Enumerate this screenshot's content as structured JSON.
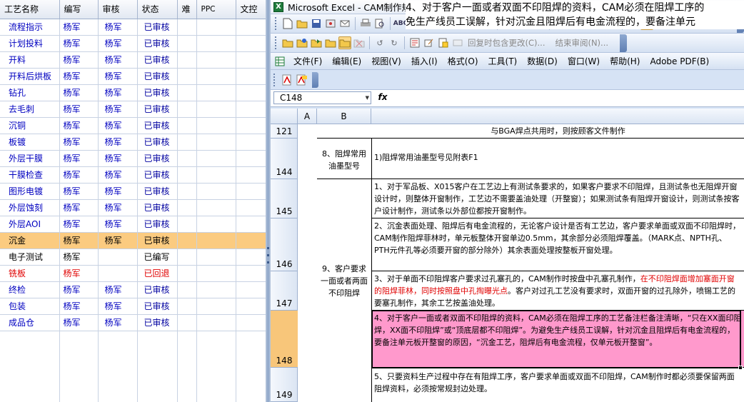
{
  "left_panel": {
    "columns": [
      "工艺名称",
      "编写",
      "审核",
      "状态",
      "难",
      "PPC",
      "文控"
    ],
    "rows": [
      {
        "name": "流程指示",
        "writer": "杨军",
        "reviewer": "杨军",
        "status": "已审核",
        "kind": "rv"
      },
      {
        "name": "计划投料",
        "writer": "杨军",
        "reviewer": "杨军",
        "status": "已审核",
        "kind": "rv"
      },
      {
        "name": "开料",
        "writer": "杨军",
        "reviewer": "杨军",
        "status": "已审核",
        "kind": "rv"
      },
      {
        "name": "开料后烘板",
        "writer": "杨军",
        "reviewer": "杨军",
        "status": "已审核",
        "kind": "rv"
      },
      {
        "name": "钻孔",
        "writer": "杨军",
        "reviewer": "杨军",
        "status": "已审核",
        "kind": "rv"
      },
      {
        "name": "去毛刺",
        "writer": "杨军",
        "reviewer": "杨军",
        "status": "已审核",
        "kind": "rv"
      },
      {
        "name": "沉铜",
        "writer": "杨军",
        "reviewer": "杨军",
        "status": "已审核",
        "kind": "rv"
      },
      {
        "name": "板镀",
        "writer": "杨军",
        "reviewer": "杨军",
        "status": "已审核",
        "kind": "rv"
      },
      {
        "name": "外层干膜",
        "writer": "杨军",
        "reviewer": "杨军",
        "status": "已审核",
        "kind": "rv"
      },
      {
        "name": "干膜检查",
        "writer": "杨军",
        "reviewer": "杨军",
        "status": "已审核",
        "kind": "rv"
      },
      {
        "name": "图形电镀",
        "writer": "杨军",
        "reviewer": "杨军",
        "status": "已审核",
        "kind": "rv"
      },
      {
        "name": "外层蚀刻",
        "writer": "杨军",
        "reviewer": "杨军",
        "status": "已审核",
        "kind": "rv"
      },
      {
        "name": "外层AOI",
        "writer": "杨军",
        "reviewer": "杨军",
        "status": "已审核",
        "kind": "rv"
      },
      {
        "name": "沉金",
        "writer": "杨军",
        "reviewer": "杨军",
        "status": "已审核",
        "kind": "sel"
      },
      {
        "name": "电子测试",
        "writer": "杨军",
        "reviewer": "",
        "status": "已编写",
        "kind": "grey"
      },
      {
        "name": "铣板",
        "writer": "杨军",
        "reviewer": "",
        "status": "已回退",
        "kind": "rej"
      },
      {
        "name": "终检",
        "writer": "杨军",
        "reviewer": "杨军",
        "status": "已审核",
        "kind": "rv"
      },
      {
        "name": "包装",
        "writer": "杨军",
        "reviewer": "杨军",
        "status": "已审核",
        "kind": "rv"
      },
      {
        "name": "成品仓",
        "writer": "杨军",
        "reviewer": "杨军",
        "status": "已审核",
        "kind": "rv"
      }
    ]
  },
  "excel": {
    "window_title": "Microsoft Excel - CAM制作规范.xls",
    "app_icon_letter": "X",
    "toolbar_reply_text": "回复时包含更改(C)...",
    "toolbar_end_review_text": "结束审阅(N)...",
    "menus": [
      "文件(F)",
      "编辑(E)",
      "视图(V)",
      "插入(I)",
      "格式(O)",
      "工具(T)",
      "数据(D)",
      "窗口(W)",
      "帮助(H)",
      "Adobe PDF(B)"
    ],
    "name_box": "C148",
    "fx_label": "fx",
    "formula_line1": "4、对于客户一面或者双面不印阻焊的资料，CAM必须在阻焊工序的",
    "formula_line2": "免生产线员工误解，针对沉金且阻焊后有电金流程的，要备注单元",
    "col_headers": {
      "a": "A",
      "b": "B"
    },
    "row_numbers": {
      "r121": "121",
      "r144": "144",
      "r145": "145",
      "r146": "146",
      "r147": "147",
      "r148": "148",
      "r149": "149"
    },
    "cells": {
      "c121": "与BGA焊点共用时，则按顾客文件制作",
      "b144": "8、阻焊常用油墨型号",
      "c144": "1)阻焊常用油墨型号见附表F1",
      "b9": "9、客户要求一面或者两面不印阻焊",
      "c145": "1、对于军品板、X015客户在工艺边上有测试条要求的，如果客户要求不印阻焊，且测试条也无阻焊开窗设计时，则整体开窗制作，工艺边不需要盖油处理（开整窗）；如果测试条有阻焊开窗设计，则测试条按客户设计制作，测试条以外部位都按开窗制作。",
      "c146": "2、沉金表面处理、阻焊后有电金流程的，无论客户设计是否有工艺边，客户要求单面或双面不印阻焊时，CAM制作阻焊菲林时，单元板整体开窗单边0.5mm，其余部分必须阻焊覆盖。（MARK点、NPTH孔、PTH元件孔等必须要开窗的部分除外）其余表面处理按整板开窗处理。",
      "c147_a": "3、对于单面不印阻焊客户要求过孔塞孔的，CAM制作时按盘中孔塞孔制作，",
      "c147_red": "在不印阻焊面增加塞面开窗的阻焊菲林，同时按照盘中孔掏曝光点",
      "c147_b": "。客户对过孔工艺没有要求时，双面开窗的过孔除外，喷锡工艺的要塞孔制作，其余工艺按盖油处理。",
      "c148": "4、对于客户一面或者双面不印阻焊的资料，CAM必须在阻焊工序的工艺备注栏备注清晰，“只在XX面印阻焊，XX面不印阻焊”或“顶底层都不印阻焊”。为避免生产线员工误解，针对沉金且阻焊后有电金流程的，要备注单元板开整窗的原因，“沉金工艺，阻焊后有电金流程，仅单元板开整窗”。",
      "c149": "5、只要资料生产过程中存在有阻焊工序，客户要求单面或双面不印阻焊，CAM制作时都必须要保留两面阻焊资料，必须按常规封边处理。"
    }
  }
}
